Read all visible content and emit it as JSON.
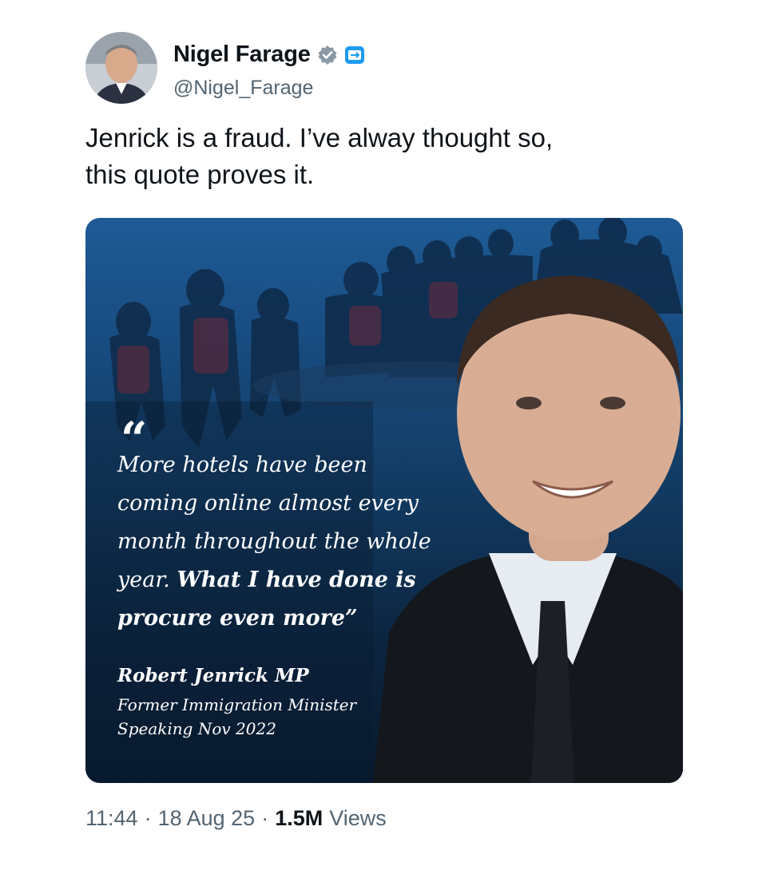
{
  "author": {
    "display_name": "Nigel Farage",
    "handle": "@Nigel_Farage",
    "avatar_icon": "avatar-photo",
    "verified_icon": "verified-badge-icon",
    "affiliation_icon": "affiliation-badge-icon"
  },
  "tweet": {
    "text_line1": "Jenrick is a fraud. I’ve alway thought so,",
    "text_line2": "this quote proves it."
  },
  "media": {
    "open_quote": "“",
    "quote_lines": [
      "More hotels have been",
      "coming online almost every",
      "month throughout the whole",
      "year. ",
      "What I have done is",
      "procure even more”"
    ],
    "attribution_name": "Robert Jenrick MP",
    "attribution_role": "Former Immigration Minister",
    "attribution_date": "Speaking Nov 2022"
  },
  "meta": {
    "time": "11:44",
    "separator": "·",
    "date": "18 Aug 25",
    "views_count": "1.5M",
    "views_label": "Views"
  },
  "colors": {
    "accent_blue": "#1d9bf0",
    "text_primary": "#0f1419",
    "text_secondary": "#536471",
    "media_top": "#1e5b96",
    "media_bottom": "#081a2e"
  }
}
